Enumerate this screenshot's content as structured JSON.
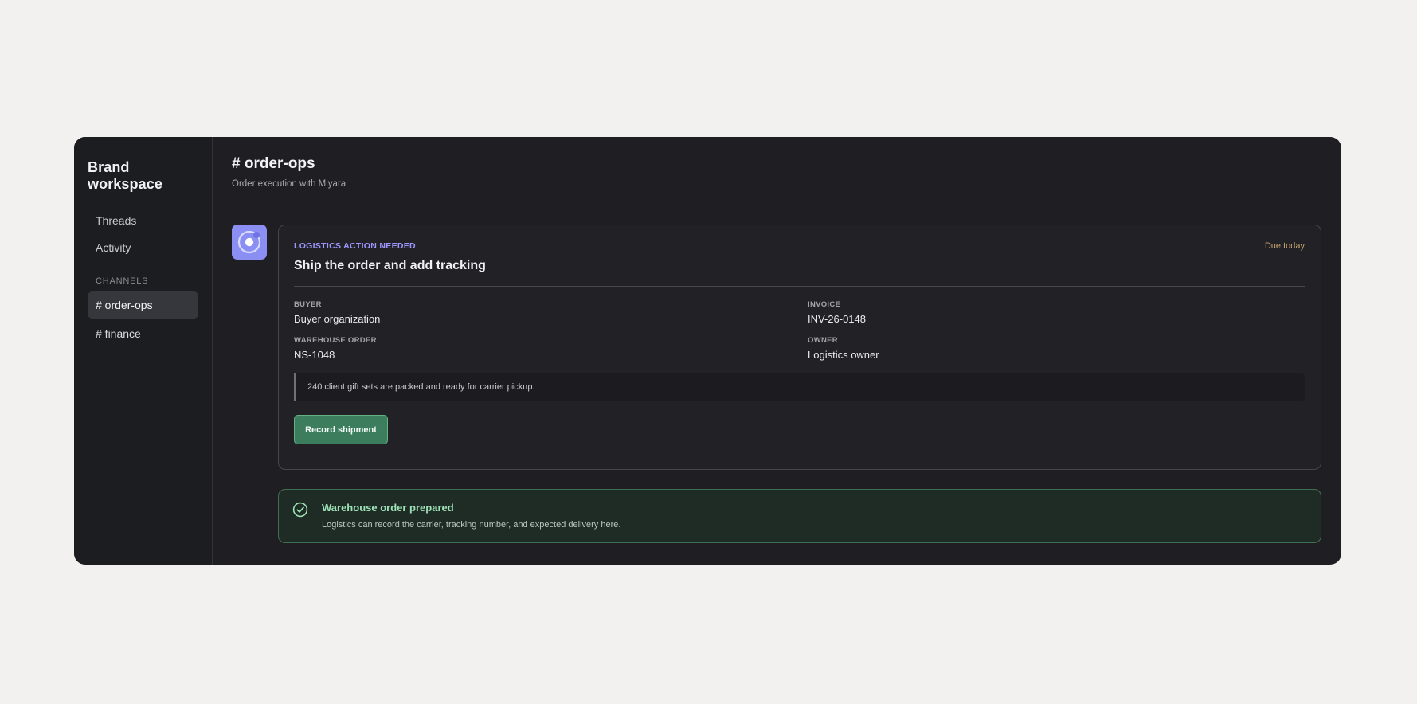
{
  "sidebar": {
    "brand": "Brand workspace",
    "nav": [
      {
        "label": "Threads"
      },
      {
        "label": "Activity"
      }
    ],
    "channels_label": "CHANNELS",
    "channels": [
      {
        "label": "# order-ops",
        "active": true
      },
      {
        "label": "# finance",
        "active": false
      }
    ]
  },
  "header": {
    "title": "# order-ops",
    "subtitle": "Order execution with Miyara"
  },
  "card": {
    "tag": "LOGISTICS ACTION NEEDED",
    "due": "Due today",
    "title": "Ship the order and add tracking",
    "fields": [
      {
        "label": "BUYER",
        "value": "Buyer organization"
      },
      {
        "label": "INVOICE",
        "value": "INV-26-0148"
      },
      {
        "label": "WAREHOUSE ORDER",
        "value": "NS-1048"
      },
      {
        "label": "OWNER",
        "value": "Logistics owner"
      }
    ],
    "note": "240 client gift sets are packed and ready for carrier pickup.",
    "button_label": "Record shipment"
  },
  "success": {
    "title": "Warehouse order prepared",
    "subtitle": "Logistics can record the carrier, tracking number, and expected delivery here."
  },
  "colors": {
    "accent": "#8b8ff3",
    "tag": "#9d97ff",
    "due": "#c7a66d",
    "button": "#3b7d5c",
    "success": "#9ee3b7"
  },
  "icons": {
    "avatar": "ring-logo-icon",
    "success": "check-circle-icon"
  }
}
